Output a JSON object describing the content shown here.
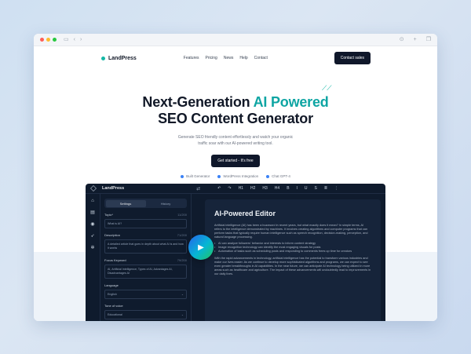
{
  "nav": {
    "brand": "LandPress",
    "links": [
      "Features",
      "Pricing",
      "News",
      "Help",
      "Contact"
    ],
    "cta": "Contact sales"
  },
  "hero": {
    "title_prefix": "Next-Generation",
    "title_accent": "AI Powered",
    "title_line2": "SEO Content Generator",
    "subtitle": "Generate SEO friendly content effortlessly and watch your organic traffic soar with our AI-powered writing tool.",
    "cta": "Get started - It's free",
    "badges": [
      "Built Generator",
      "WordPress Integration",
      "Chat GPT-4"
    ]
  },
  "app": {
    "name": "LandPress",
    "toolbar": [
      "↶",
      "↷",
      "H1",
      "H2",
      "H3",
      "H4",
      "B",
      "I",
      "U",
      "S",
      "≣",
      "⋮"
    ],
    "tabs": [
      "Settings",
      "History"
    ],
    "fields": {
      "type_label": "Topic*",
      "type_count": "11/200",
      "type_value": "What is AI?",
      "desc_label": "Description",
      "desc_count": "71/200",
      "desc_value": "A detailed article that goes in depth about what AI is and how it works",
      "kw_label": "Focus Keyword",
      "kw_count": "79/200",
      "kw_value": "AI, Artificial Intelligence, Types of AI, Advantages AI, Disadvantages AI",
      "lang_label": "Language",
      "lang_value": "English",
      "tone_label": "Tone of voice",
      "tone_value": "Educational"
    },
    "editor": {
      "title": "AI-Powered Editor",
      "p1": "Artificial intelligence (AI) has been a buzzword in recent years, but what exactly does it mean? In simple terms, AI refers to the intelligence demonstrated by machines. It involves creating algorithms and computer programs that can perform tasks that typically require human intelligence such as speech recognition, decision-making, perception, and natural language processing.",
      "bullets": [
        "AI can analyze followers' behavior and interests to inform content strategy",
        "Image recognition technology can identify the most engaging visuals for posts",
        "Automation of tasks such as scheduling posts and responding to comments frees up time for creators"
      ],
      "p2": "With the rapid advancements in technology, artificial intelligence has the potential to transform various industries and make our lives easier. As we continue to develop more sophisticated algorithms and programs, we can expect to see even greater breakthroughs in AI capabilities. In the near future, we can anticipate AI technology being utilized in more areas such as healthcare and agriculture. The impact of these advancements will undoubtedly lead to improvements in our daily lives."
    }
  }
}
